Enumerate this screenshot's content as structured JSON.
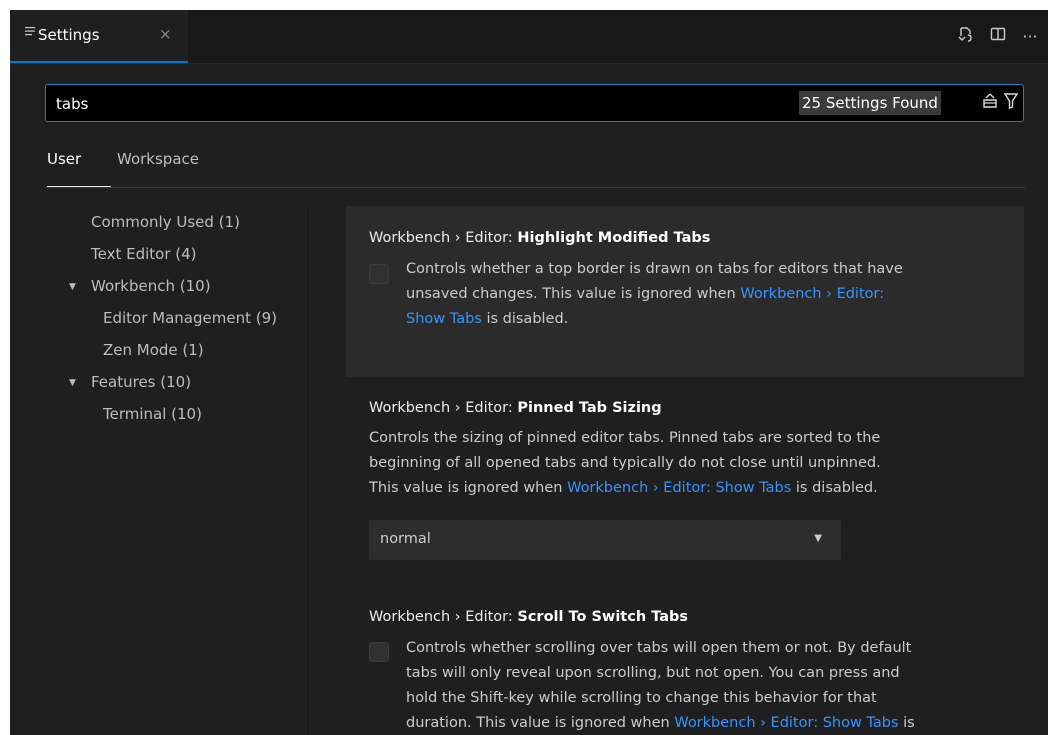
{
  "tab": {
    "icon": "settings-list-icon",
    "label": "Settings",
    "close": "×"
  },
  "actions": [
    {
      "name": "open-json-icon",
      "glyph": "⎌"
    },
    {
      "name": "split-editor-icon",
      "glyph": "◫"
    },
    {
      "name": "more-actions-icon",
      "glyph": "···"
    }
  ],
  "search": {
    "value": "tabs",
    "count": "25 Settings Found"
  },
  "scope": {
    "user": "User",
    "workspace": "Workspace"
  },
  "toc": [
    {
      "label": "Commonly Used (1)"
    },
    {
      "label": "Text Editor (4)"
    },
    {
      "label": "Workbench (10)"
    },
    {
      "label": "Editor Management (9)"
    },
    {
      "label": "Zen Mode (1)"
    },
    {
      "label": "Features (10)"
    },
    {
      "label": "Terminal (10)"
    }
  ],
  "settings": [
    {
      "category": "Workbench › Editor: ",
      "name": "Highlight Modified Tabs",
      "desc1": "Controls whether a top border is drawn on tabs for editors that have",
      "desc2a": "unsaved changes. This value is ignored when ",
      "desc2link": "Workbench › Editor:",
      "desc3link": "Show Tabs",
      "desc3b": " is disabled."
    },
    {
      "category": "Workbench › Editor: ",
      "name": "Pinned Tab Sizing",
      "desc1": "Controls the sizing of pinned editor tabs. Pinned tabs are sorted to the",
      "desc2": "beginning of all opened tabs and typically do not close until unpinned.",
      "desc3a": "This value is ignored when ",
      "desc3link": "Workbench › Editor: Show Tabs",
      "desc3b": " is disabled.",
      "select_value": "normal"
    },
    {
      "category": "Workbench › Editor: ",
      "name": "Scroll To Switch Tabs",
      "desc1": "Controls whether scrolling over tabs will open them or not. By default",
      "desc2": "tabs will only reveal upon scrolling, but not open. You can press and",
      "desc3": "hold the Shift-key while scrolling to change this behavior for that",
      "desc4a": "duration. This value is ignored when ",
      "desc4link": "Workbench › Editor: Show Tabs",
      "desc4b": " is"
    }
  ]
}
